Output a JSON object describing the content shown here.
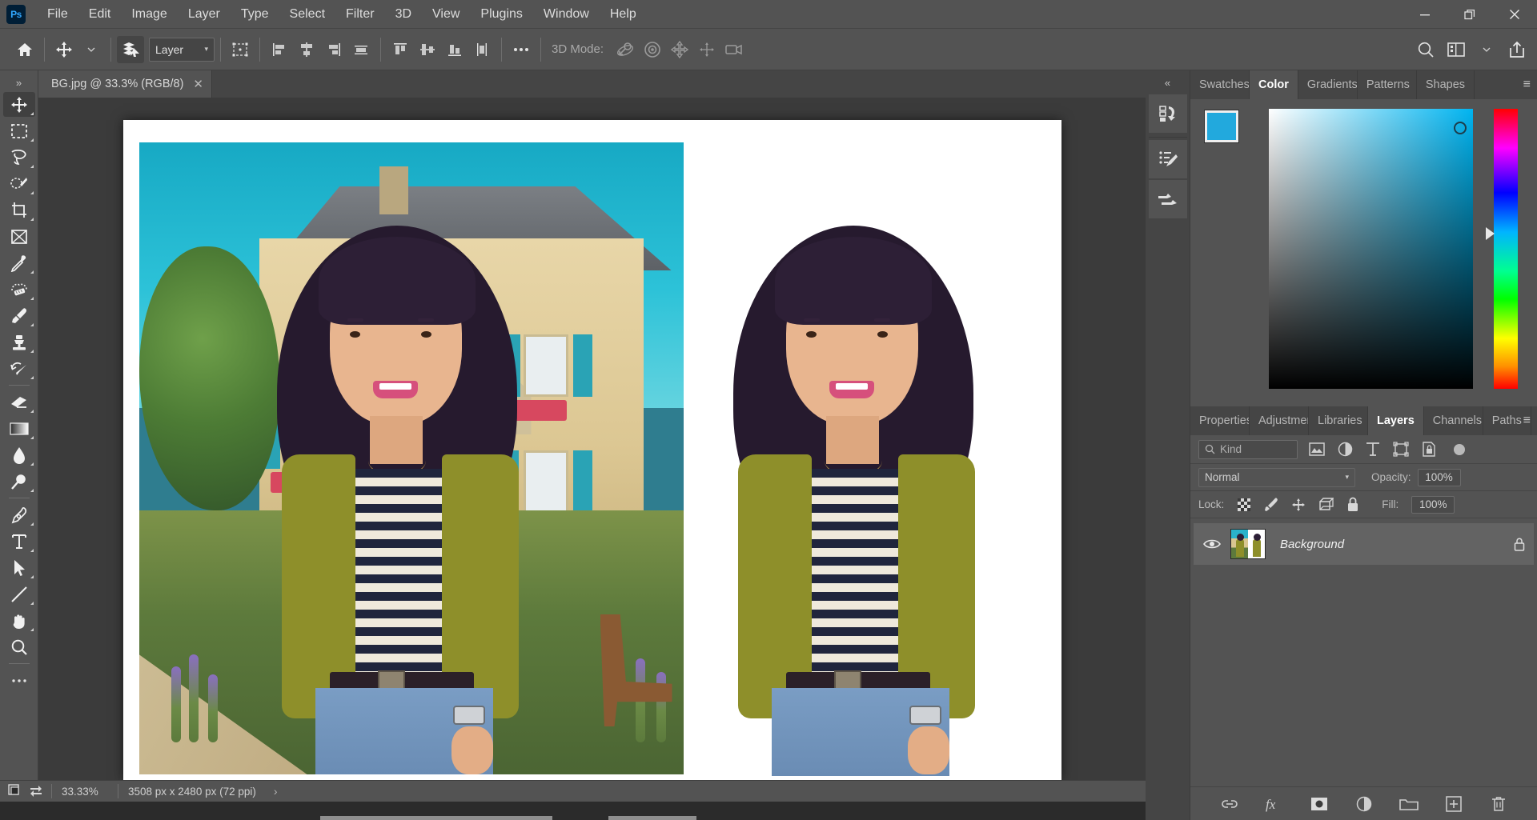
{
  "app": {
    "name": "Adobe Photoshop",
    "logo_text": "Ps"
  },
  "menubar": {
    "items": [
      {
        "label": "File"
      },
      {
        "label": "Edit"
      },
      {
        "label": "Image"
      },
      {
        "label": "Layer"
      },
      {
        "label": "Type"
      },
      {
        "label": "Select"
      },
      {
        "label": "Filter"
      },
      {
        "label": "3D"
      },
      {
        "label": "View"
      },
      {
        "label": "Plugins"
      },
      {
        "label": "Window"
      },
      {
        "label": "Help"
      }
    ],
    "window_controls": {
      "minimize": "—",
      "maximize": "❐",
      "close": "✕"
    }
  },
  "options_bar": {
    "home_icon": "home-icon",
    "tool_icon": "move-tool-icon",
    "auto_select_icon": "layers-stack-icon",
    "auto_select_value": "Layer",
    "transform_controls_icon": "transform-controls-icon",
    "align_group_label": "Align",
    "more_label": "•••",
    "mode_3d_label": "3D Mode:",
    "search_icon": "search-icon",
    "workspace_icon": "workspace-icon",
    "share_icon": "share-icon"
  },
  "toolbar": {
    "collapse_glyph": "»",
    "tools": [
      {
        "name": "move-tool",
        "active": true
      },
      {
        "name": "rectangular-marquee-tool",
        "active": false
      },
      {
        "name": "lasso-tool",
        "active": false
      },
      {
        "name": "object-selection-tool",
        "active": false
      },
      {
        "name": "crop-tool",
        "active": false
      },
      {
        "name": "frame-tool",
        "active": false
      },
      {
        "name": "eyedropper-tool",
        "active": false
      },
      {
        "name": "spot-healing-brush-tool",
        "active": false
      },
      {
        "name": "brush-tool",
        "active": false
      },
      {
        "name": "clone-stamp-tool",
        "active": false
      },
      {
        "name": "history-brush-tool",
        "active": false
      },
      {
        "name": "eraser-tool",
        "active": false
      },
      {
        "name": "gradient-tool",
        "active": false
      },
      {
        "name": "blur-tool",
        "active": false
      },
      {
        "name": "dodge-tool",
        "active": false
      },
      {
        "name": "pen-tool",
        "active": false
      },
      {
        "name": "type-tool",
        "active": false
      },
      {
        "name": "path-selection-tool",
        "active": false
      },
      {
        "name": "line-tool",
        "active": false
      },
      {
        "name": "hand-tool",
        "active": false
      },
      {
        "name": "zoom-tool",
        "active": false
      },
      {
        "name": "edit-toolbar",
        "active": false
      }
    ],
    "foreground_color": "#22a9dd",
    "background_color": "#ffffff"
  },
  "document": {
    "tab_title": "BG.jpg @ 33.3% (RGB/8)",
    "close_glyph": "✕"
  },
  "status_bar": {
    "zoom": "33.33%",
    "dimensions": "3508 px x 2480 px (72 ppi)",
    "arrow_glyph": "›"
  },
  "right_dock": {
    "collapse_glyph": "«",
    "rail_icons": [
      {
        "name": "history-icon"
      },
      {
        "name": "brush-settings-icon"
      },
      {
        "name": "brushes-icon"
      }
    ]
  },
  "color_panel": {
    "tabs": [
      {
        "label": "Swatches",
        "active": false
      },
      {
        "label": "Color",
        "active": true
      },
      {
        "label": "Gradients",
        "active": false
      },
      {
        "label": "Patterns",
        "active": false
      },
      {
        "label": "Shapes",
        "active": false
      }
    ],
    "menu_glyph": "≡",
    "foreground": "#22a9dd",
    "background": "#ffffff",
    "picker_type": "hue-cube",
    "hue_marker_position_pct": 42
  },
  "layers_panel": {
    "tabs": [
      {
        "label": "Properties",
        "active": false
      },
      {
        "label": "Adjustments",
        "active": false
      },
      {
        "label": "Libraries",
        "active": false
      },
      {
        "label": "Layers",
        "active": true
      },
      {
        "label": "Channels",
        "active": false
      },
      {
        "label": "Paths",
        "active": false
      }
    ],
    "menu_glyph": "≡",
    "filter": {
      "search_icon": "search-icon",
      "kind_label": "Kind",
      "icons": [
        {
          "name": "filter-pixel-icon"
        },
        {
          "name": "filter-adjustment-icon"
        },
        {
          "name": "filter-type-icon"
        },
        {
          "name": "filter-shape-icon"
        },
        {
          "name": "filter-smart-object-icon"
        }
      ],
      "toggle_name": "filter-toggle"
    },
    "blend_mode": "Normal",
    "blend_caret": "∨",
    "opacity_label": "Opacity:",
    "opacity_value": "100%",
    "lock_label": "Lock:",
    "lock_icons": [
      {
        "name": "lock-transparency-icon"
      },
      {
        "name": "lock-image-icon"
      },
      {
        "name": "lock-position-icon"
      },
      {
        "name": "lock-artboard-icon"
      },
      {
        "name": "lock-all-icon"
      }
    ],
    "fill_label": "Fill:",
    "fill_value": "100%",
    "layers": [
      {
        "name": "Background",
        "visible": true,
        "locked": true,
        "eye_icon": "eye-icon",
        "lock_icon": "lock-icon"
      }
    ],
    "footer_icons": [
      {
        "name": "link-layers-icon"
      },
      {
        "name": "layer-style-fx-icon"
      },
      {
        "name": "layer-mask-icon"
      },
      {
        "name": "adjustment-layer-icon"
      },
      {
        "name": "new-group-icon"
      },
      {
        "name": "new-layer-icon"
      },
      {
        "name": "delete-layer-icon"
      }
    ]
  },
  "canvas": {
    "left_image_alt": "portrait-with-cottage-garden-background",
    "right_image_alt": "portrait-on-white-background",
    "background_color": "#3b3b3b",
    "document_background": "#ffffff"
  }
}
